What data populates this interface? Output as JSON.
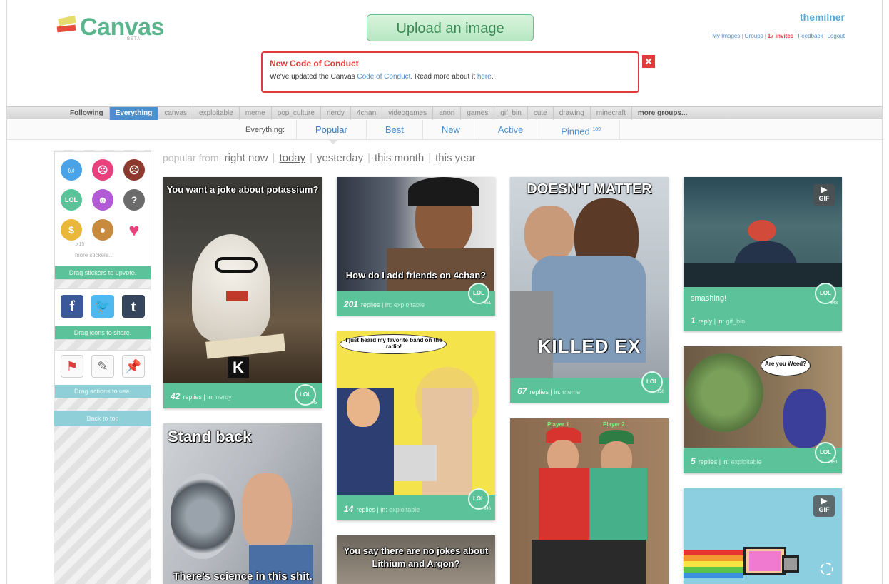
{
  "colors": {
    "brand": "#5ab58d",
    "accent": "#4b8fcf",
    "alert": "#e23b3b",
    "card_footer": "#5cc29a"
  },
  "header": {
    "logo_text": "Canvas",
    "logo_beta": "BETA",
    "upload_label": "Upload an image",
    "username": "themilner",
    "links": {
      "my_images": "My Images",
      "groups": "Groups",
      "invites": "17 invites",
      "feedback": "Feedback",
      "logout": "Logout"
    }
  },
  "notice": {
    "title": "New Code of Conduct",
    "text_before": "We've updated the Canvas ",
    "link1": "Code of Conduct",
    "text_mid": ". Read more about it ",
    "link2": "here",
    "text_after": ".",
    "close_glyph": "✕"
  },
  "groups": [
    "Following",
    "Everything",
    "canvas",
    "exploitable",
    "meme",
    "pop_culture",
    "nerdy",
    "4chan",
    "videogames",
    "anon",
    "games",
    "gif_bin",
    "cute",
    "drawing",
    "minecraft",
    "more groups..."
  ],
  "sort": {
    "label": "Everything:",
    "tabs": [
      "Popular",
      "Best",
      "New",
      "Active",
      "Pinned"
    ],
    "pinned_count": "189"
  },
  "filter": {
    "prefix": "popular from:",
    "options": [
      "right now",
      "today",
      "yesterday",
      "this month",
      "this year"
    ]
  },
  "sidebar": {
    "stickers_more": "more stickers...",
    "stickers_count": "x15",
    "stickers_hint": "Drag stickers to upvote.",
    "share_hint": "Drag icons to share.",
    "actions_hint": "Drag actions to use.",
    "back_to_top": "Back to top"
  },
  "cards": [
    {
      "caption": "You want a joke about potassium?",
      "caption2": "K",
      "replies": "42",
      "group": "nerdy",
      "lol": "x43"
    },
    {
      "caption": "Stand back",
      "caption2": "There's science in this shit."
    },
    {
      "caption": "How do I add friends on 4chan?",
      "replies": "201",
      "group": "exploitable",
      "lol": "x51"
    },
    {
      "caption": "I just heard my favorite band on the radio!",
      "replies": "14",
      "group": "exploitable",
      "lol": "x46"
    },
    {
      "caption": "You say there are no jokes about",
      "caption2": "Lithium and Argon?"
    },
    {
      "caption": "DOESN'T MATTER",
      "caption2": "KILLED EX",
      "replies": "67",
      "group": "meme",
      "lol": "x50"
    },
    {
      "caption": "Player 1",
      "caption2": "Player 2"
    },
    {
      "text": "smashing!",
      "replies": "1",
      "reply_word": "reply",
      "group": "gif_bin",
      "lol": "x43"
    },
    {
      "caption": "Are you Weed?",
      "replies": "5",
      "group": "exploitable",
      "lol": "x51"
    },
    {
      "gif": "GIF"
    }
  ],
  "common": {
    "replies_word": "replies",
    "in_word": "in:",
    "lol_label": "LOL",
    "gif_label": "GIF"
  }
}
